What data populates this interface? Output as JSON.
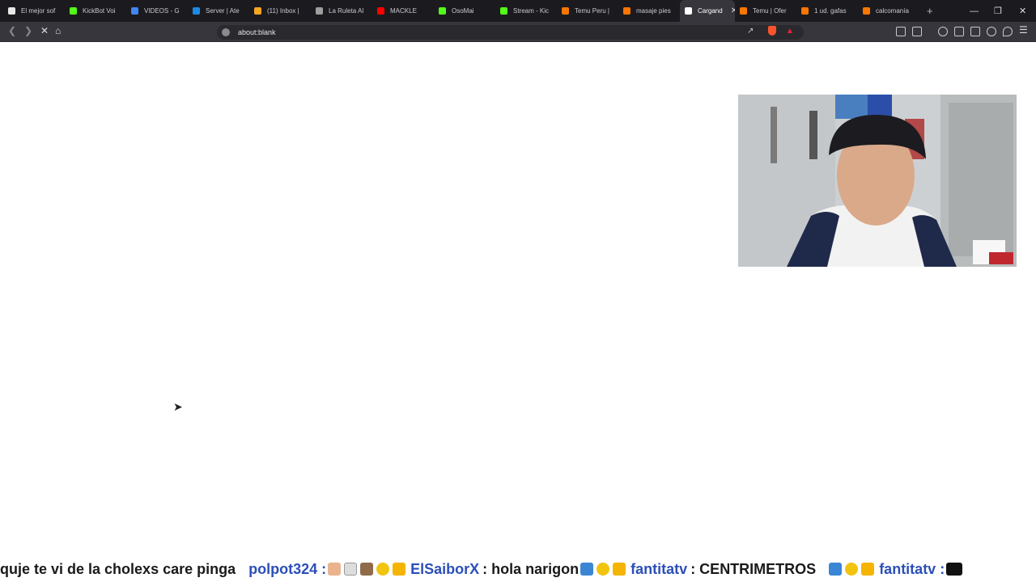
{
  "tabs": [
    {
      "label": "El mejor sof",
      "color": "#e8e8e8"
    },
    {
      "label": "KickBot Voi",
      "color": "#53fc18"
    },
    {
      "label": "VIDEOS - G",
      "color": "#4285f4"
    },
    {
      "label": "Server | Ate",
      "color": "#1e88e5"
    },
    {
      "label": "(11) Inbox |",
      "color": "#f5a623"
    },
    {
      "label": "La Ruleta Al",
      "color": "#9e9e9e"
    },
    {
      "label": "MACKLE",
      "color": "#ff0000"
    },
    {
      "label": "OsoMai",
      "color": "#53fc18"
    },
    {
      "label": "Stream - Kic",
      "color": "#53fc18"
    },
    {
      "label": "Temu Peru |",
      "color": "#fb7701"
    },
    {
      "label": "masaje pies",
      "color": "#fb7701"
    },
    {
      "label": "Cargand",
      "color": "#ffffff",
      "active": true
    },
    {
      "label": "Temu | Ofer",
      "color": "#fb7701"
    },
    {
      "label": "1 ud. gafas",
      "color": "#fb7701"
    },
    {
      "label": "calcomanía",
      "color": "#fb7701"
    }
  ],
  "address": {
    "url": "about:blank"
  },
  "ticker": {
    "text1": "quje te vi de la cholexs care pinga",
    "user1": "polpot324 :",
    "user2": "ElSaiborX",
    "text2": ": hola narigon",
    "user3": "fantitatv",
    "text3": ": CENTRIMETROS",
    "user4": "fantitatv :"
  }
}
